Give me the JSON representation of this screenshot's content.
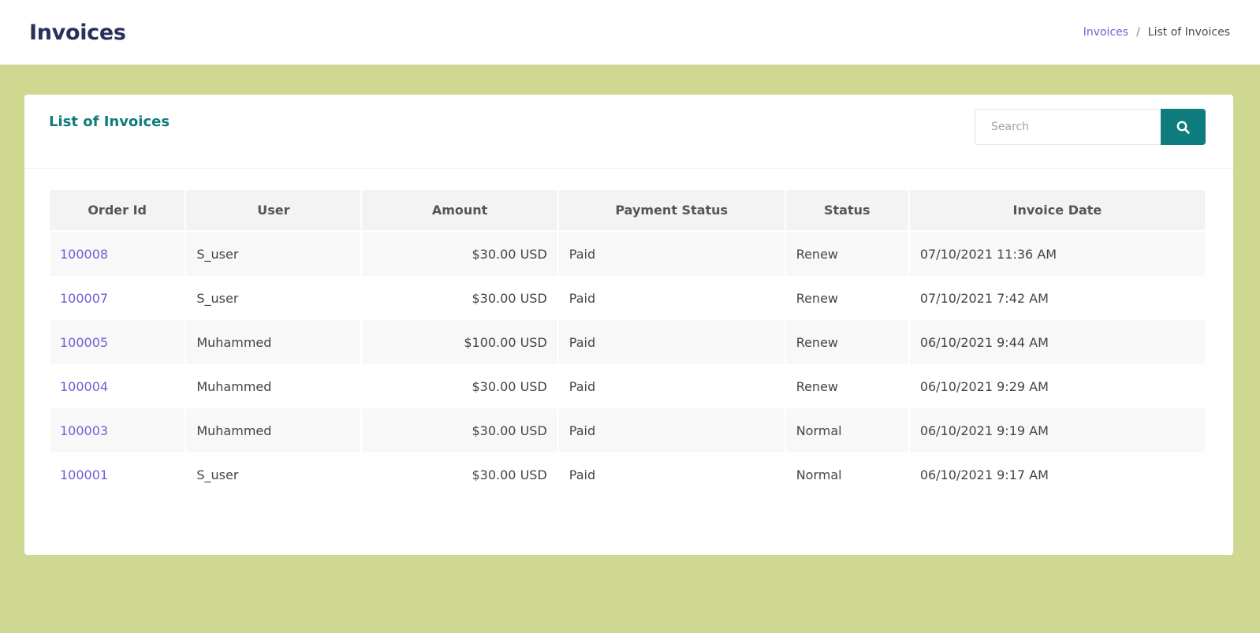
{
  "header": {
    "title": "Invoices",
    "breadcrumb": {
      "link": "Invoices",
      "separator": "/",
      "current": "List of Invoices"
    }
  },
  "card": {
    "title": "List of Invoices",
    "search": {
      "placeholder": "Search",
      "value": "",
      "icon": "search-icon"
    }
  },
  "table": {
    "columns": [
      "Order Id",
      "User",
      "Amount",
      "Payment Status",
      "Status",
      "Invoice Date"
    ],
    "rows": [
      {
        "order_id": "100008",
        "user": "S_user",
        "amount": "$30.00 USD",
        "payment_status": "Paid",
        "status": "Renew",
        "invoice_date": "07/10/2021 11:36 AM"
      },
      {
        "order_id": "100007",
        "user": "S_user",
        "amount": "$30.00 USD",
        "payment_status": "Paid",
        "status": "Renew",
        "invoice_date": "07/10/2021 7:42 AM"
      },
      {
        "order_id": "100005",
        "user": "Muhammed",
        "amount": "$100.00 USD",
        "payment_status": "Paid",
        "status": "Renew",
        "invoice_date": "06/10/2021 9:44 AM"
      },
      {
        "order_id": "100004",
        "user": "Muhammed",
        "amount": "$30.00 USD",
        "payment_status": "Paid",
        "status": "Renew",
        "invoice_date": "06/10/2021 9:29 AM"
      },
      {
        "order_id": "100003",
        "user": "Muhammed",
        "amount": "$30.00 USD",
        "payment_status": "Paid",
        "status": "Normal",
        "invoice_date": "06/10/2021 9:19 AM"
      },
      {
        "order_id": "100001",
        "user": "S_user",
        "amount": "$30.00 USD",
        "payment_status": "Paid",
        "status": "Normal",
        "invoice_date": "06/10/2021 9:17 AM"
      }
    ]
  },
  "colors": {
    "background": "#cfd891",
    "accent": "#0f7d7d",
    "link": "#6e5fd6",
    "title": "#2a2f5b"
  }
}
